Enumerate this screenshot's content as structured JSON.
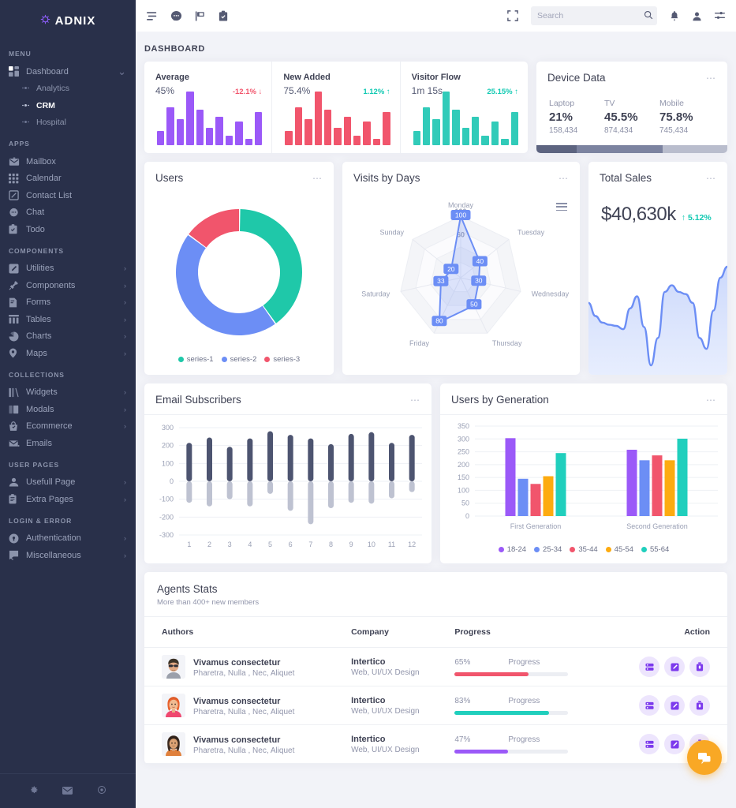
{
  "brand": {
    "name": "ADNIX",
    "mark": "brand-logo-icon"
  },
  "sidebar": {
    "sections": [
      {
        "label": "MENU",
        "items": [
          {
            "label": "Dashboard",
            "icon": "grid-icon",
            "arrow": "chevron-down-icon",
            "children": [
              {
                "label": "Analytics",
                "active": false
              },
              {
                "label": "CRM",
                "active": true
              },
              {
                "label": "Hospital",
                "active": false
              }
            ]
          }
        ]
      },
      {
        "label": "APPS",
        "items": [
          {
            "label": "Mailbox",
            "icon": "envelope-icon"
          },
          {
            "label": "Calendar",
            "icon": "calendar-icon"
          },
          {
            "label": "Contact List",
            "icon": "contact-icon"
          },
          {
            "label": "Chat",
            "icon": "chat-icon"
          },
          {
            "label": "Todo",
            "icon": "clipboard-check-icon"
          }
        ]
      },
      {
        "label": "COMPONENTS",
        "items": [
          {
            "label": "Utilities",
            "icon": "pencil-square-icon",
            "arrow": "chevron-right-icon"
          },
          {
            "label": "Components",
            "icon": "plug-icon",
            "arrow": "chevron-right-icon"
          },
          {
            "label": "Forms",
            "icon": "form-icon",
            "arrow": "chevron-right-icon"
          },
          {
            "label": "Tables",
            "icon": "table-icon",
            "arrow": "chevron-right-icon"
          },
          {
            "label": "Charts",
            "icon": "pie-chart-icon",
            "arrow": "chevron-right-icon"
          },
          {
            "label": "Maps",
            "icon": "map-pin-icon",
            "arrow": "chevron-right-icon"
          }
        ]
      },
      {
        "label": "COLLECTIONS",
        "items": [
          {
            "label": "Widgets",
            "icon": "widgets-icon",
            "arrow": "chevron-right-icon"
          },
          {
            "label": "Modals",
            "icon": "book-icon",
            "arrow": "chevron-right-icon"
          },
          {
            "label": "Ecommerce",
            "icon": "basket-icon",
            "arrow": "chevron-right-icon"
          },
          {
            "label": "Emails",
            "icon": "mail-open-icon"
          }
        ]
      },
      {
        "label": "USER PAGES",
        "items": [
          {
            "label": "Usefull Page",
            "icon": "user-icon",
            "arrow": "chevron-right-icon"
          },
          {
            "label": "Extra Pages",
            "icon": "clipboard-icon",
            "arrow": "chevron-right-icon"
          }
        ]
      },
      {
        "label": "LOGIN & ERROR",
        "items": [
          {
            "label": "Authentication",
            "icon": "lock-icon",
            "arrow": "chevron-right-icon"
          },
          {
            "label": "Miscellaneous",
            "icon": "flag-icon",
            "arrow": "chevron-right-icon"
          }
        ]
      }
    ],
    "footer_icons": [
      "gear-icon",
      "envelope-icon",
      "power-icon"
    ]
  },
  "topbar": {
    "left_icons": [
      "menu-toggle-icon",
      "chat-bubble-icon",
      "flag-icon",
      "clipboard-check-icon"
    ],
    "fullscreen_icon": "fullscreen-icon",
    "search": {
      "placeholder": "Search",
      "value": "",
      "icon": "search-icon"
    },
    "right_icons": [
      "bell-icon",
      "user-icon",
      "settings-sliders-icon"
    ]
  },
  "page": {
    "title": "DASHBOARD"
  },
  "stats": [
    {
      "name": "Average",
      "value": "45%",
      "delta": "-12.1%",
      "dir": "down",
      "color": "#9b59f8",
      "bars": [
        18,
        48,
        33,
        68,
        45,
        22,
        36,
        12,
        30,
        8,
        42
      ]
    },
    {
      "name": "New Added",
      "value": "75.4%",
      "delta": "1.12%",
      "dir": "up",
      "color": "#f1556c",
      "bars": [
        18,
        48,
        33,
        68,
        45,
        22,
        36,
        12,
        30,
        8,
        42
      ]
    },
    {
      "name": "Visitor Flow",
      "value": "1m 15s",
      "delta": "25.15%",
      "dir": "up",
      "color": "#31cbb9",
      "bars": [
        18,
        48,
        33,
        68,
        45,
        22,
        36,
        12,
        30,
        8,
        42
      ]
    }
  ],
  "device_data": {
    "title": "Device Data",
    "menu_icon": "more-options-icon",
    "items": [
      {
        "label": "Laptop",
        "pct": "21%",
        "count": "158,434",
        "bar_pct": 21,
        "color": "#5d6480"
      },
      {
        "label": "TV",
        "pct": "45.5%",
        "count": "874,434",
        "bar_pct": 45,
        "color": "#7c83a0"
      },
      {
        "label": "Mobile",
        "pct": "75.8%",
        "count": "745,434",
        "bar_pct": 34,
        "color": "#b9bdcd"
      }
    ]
  },
  "cards": {
    "users": {
      "title": "Users",
      "menu_icon": "more-options-icon"
    },
    "visits": {
      "title": "Visits by Days",
      "menu_icon": "more-options-icon",
      "hamburger_icon": "chart-menu-icon"
    },
    "total_sales": {
      "title": "Total Sales",
      "menu_icon": "more-options-icon",
      "amount": "$40,630k",
      "delta": "5.12%",
      "delta_icon": "arrow-up-icon"
    },
    "email_subscribers": {
      "title": "Email Subscribers",
      "menu_icon": "more-options-icon"
    },
    "users_by_generation": {
      "title": "Users by Generation",
      "menu_icon": "more-options-icon"
    }
  },
  "agents": {
    "title": "Agents Stats",
    "subtitle": "More than 400+ new members",
    "columns": [
      "Authors",
      "Company",
      "Progress",
      "Action"
    ],
    "progress_label": "Progress",
    "rows": [
      {
        "name": "Vivamus consectetur",
        "tags": "Pharetra, Nulla , Nec, Aliquet",
        "company": "Intertico",
        "company_sub": "Web, UI/UX Design",
        "progress": "65%",
        "progress_value": 65,
        "progress_color": "#f1556c",
        "avatar": "avatar-man-sunglasses",
        "actions": [
          "view-icon",
          "edit-icon",
          "delete-icon"
        ]
      },
      {
        "name": "Vivamus consectetur",
        "tags": "Pharetra, Nulla , Nec, Aliquet",
        "company": "Intertico",
        "company_sub": "Web, UI/UX Design",
        "progress": "83%",
        "progress_value": 83,
        "progress_color": "#20cfbd",
        "avatar": "avatar-woman-red-hair",
        "actions": [
          "view-icon",
          "edit-icon",
          "delete-icon"
        ]
      },
      {
        "name": "Vivamus consectetur",
        "tags": "Pharetra, Nulla , Nec, Aliquet",
        "company": "Intertico",
        "company_sub": "Web, UI/UX Design",
        "progress": "47%",
        "progress_value": 47,
        "progress_color": "#9b59f8",
        "avatar": "avatar-woman-dark-hair",
        "actions": [
          "view-icon",
          "edit-icon",
          "delete-icon"
        ]
      }
    ]
  },
  "fab": {
    "icon": "chat-support-icon",
    "color": "#f9a825"
  },
  "chart_data": [
    {
      "type": "pie",
      "title": "Users",
      "labels": [
        "series-1",
        "series-2",
        "series-3"
      ],
      "values": [
        40,
        45,
        15
      ],
      "colors": [
        "#1fc8a9",
        "#6c8ef5",
        "#f1556c"
      ],
      "legend_position": "bottom",
      "donut": true
    },
    {
      "type": "radar",
      "title": "Visits by Days",
      "categories": [
        "Monday",
        "Tuesday",
        "Wednesday",
        "Thursday",
        "Friday",
        "Saturday",
        "Sunday"
      ],
      "values": [
        100,
        40,
        30,
        50,
        80,
        33,
        20
      ],
      "tick_labels": [
        "100",
        "60"
      ],
      "ylim": [
        0,
        100
      ],
      "color": "#6c8ef5",
      "data_labels": true
    },
    {
      "type": "area",
      "title": "Total Sales",
      "values": [
        62,
        50,
        44,
        42,
        41,
        38,
        57,
        68,
        40,
        5,
        30,
        72,
        78,
        72,
        70,
        62,
        30,
        20,
        55,
        85,
        95
      ],
      "color": "#6c8ef5",
      "grid": false
    },
    {
      "type": "bar",
      "title": "Email Subscribers",
      "categories": [
        "1",
        "2",
        "3",
        "4",
        "5",
        "6",
        "7",
        "8",
        "9",
        "10",
        "11",
        "12"
      ],
      "series": [
        {
          "name": "positive",
          "values": [
            215,
            245,
            193,
            240,
            280,
            260,
            240,
            208,
            265,
            275,
            215,
            260
          ],
          "color": "#4d5470"
        },
        {
          "name": "negative",
          "values": [
            -120,
            -140,
            -100,
            -140,
            -70,
            -165,
            -240,
            -150,
            -120,
            -125,
            -95,
            -60
          ],
          "color": "#bec2d1"
        }
      ],
      "ylim": [
        -300,
        300
      ],
      "yticks": [
        300,
        200,
        100,
        0,
        -100,
        -200,
        -300
      ],
      "xlabel": "",
      "ylabel": "",
      "grid": true
    },
    {
      "type": "bar",
      "title": "Users by Generation",
      "categories": [
        "First Generation",
        "Second Generation"
      ],
      "series": [
        {
          "name": "18-24",
          "values": [
            303,
            258
          ],
          "color": "#9b59f8"
        },
        {
          "name": "25-34",
          "values": [
            145,
            217
          ],
          "color": "#6c8ef5"
        },
        {
          "name": "35-44",
          "values": [
            125,
            236
          ],
          "color": "#f1556c"
        },
        {
          "name": "45-54",
          "values": [
            155,
            217
          ],
          "color": "#fdab10"
        },
        {
          "name": "55-64",
          "values": [
            245,
            301
          ],
          "color": "#20cfbd"
        }
      ],
      "ylim": [
        0,
        350
      ],
      "yticks": [
        350,
        300,
        250,
        200,
        150,
        100,
        50,
        0
      ],
      "legend_position": "bottom",
      "grid": true
    }
  ]
}
